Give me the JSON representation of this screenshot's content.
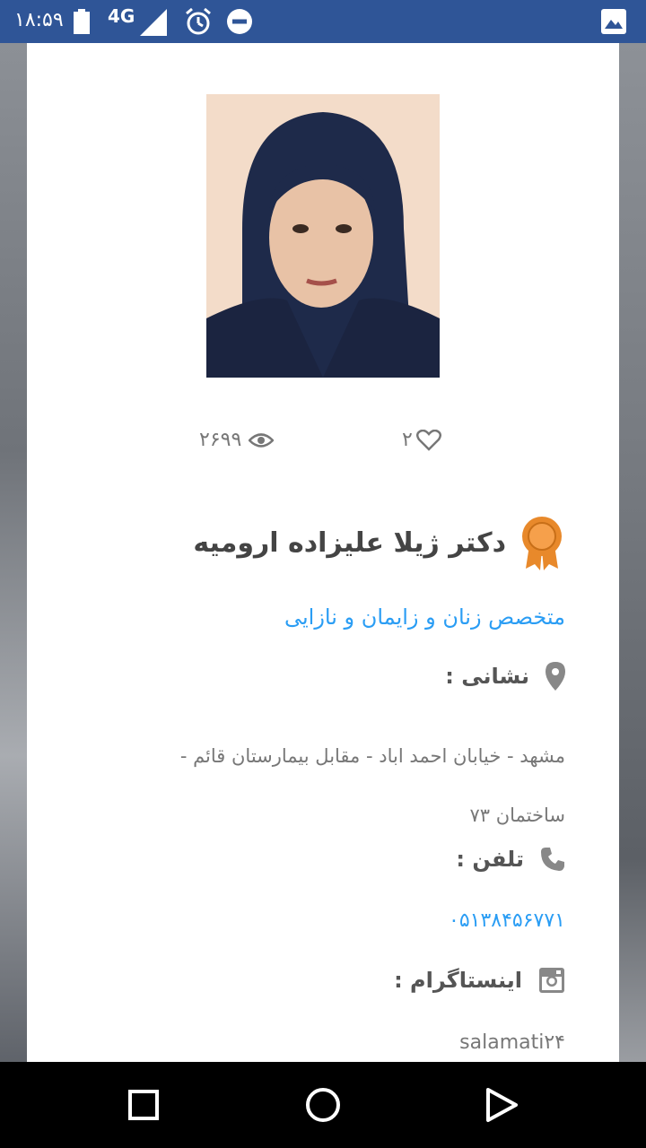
{
  "status_bar": {
    "time": "۱۸:۵۹",
    "network": "4G",
    "icons": [
      "battery-icon",
      "signal-icon",
      "alarm-icon",
      "do-not-disturb-icon",
      "gallery-icon"
    ]
  },
  "profile": {
    "views": "۲۶۹۹",
    "likes": "۲",
    "name": "دکتر ژیلا علیزاده ارومیه",
    "specialty": "متخصص زنان و زایمان و نازایی",
    "address_label": "نشانی :",
    "address_value": "مشهد - خیابان احمد اباد - مقابل بیمارستان قائم - ساختمان ۷۳",
    "phone_label": "تلفن :",
    "phone_value": "۰۵۱۳۸۴۵۶۷۷۱",
    "instagram_label": "اینستاگرام :",
    "instagram_value": "salamati۲۴"
  },
  "colors": {
    "status_bar": "#2f5597",
    "link_blue": "#2a9df4",
    "badge_orange": "#e8892b"
  },
  "nav_bar": {
    "icons": [
      "recent-apps-icon",
      "home-icon",
      "back-icon"
    ]
  }
}
